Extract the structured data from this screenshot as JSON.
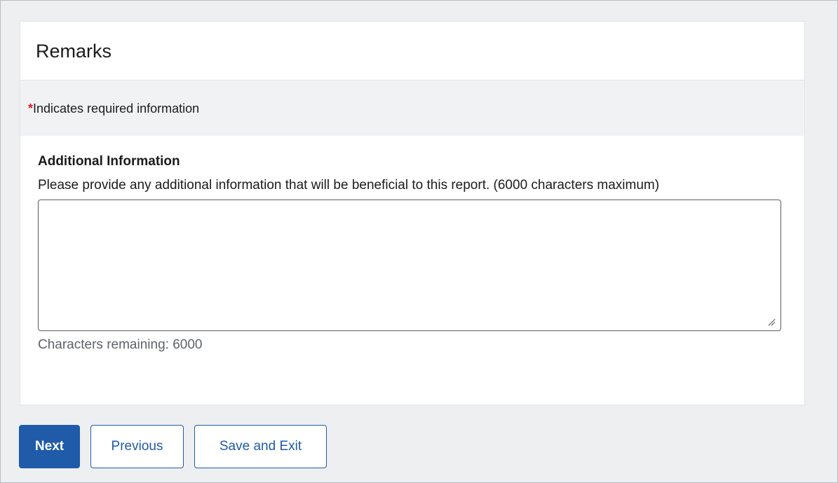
{
  "card": {
    "title": "Remarks"
  },
  "required_note": {
    "star": "*",
    "text": "Indicates required information"
  },
  "additional_info": {
    "heading": "Additional Information",
    "description": "Please provide any additional information that will be beneficial to this report. (6000 characters maximum)",
    "value": "",
    "placeholder": "",
    "chars_label": "Characters remaining:",
    "chars_remaining": "6000"
  },
  "buttons": {
    "next": "Next",
    "previous": "Previous",
    "save_exit": "Save and Exit"
  },
  "colors": {
    "primary": "#1f5ba8",
    "required": "#d21f24",
    "page_bg": "#eeeff1"
  }
}
